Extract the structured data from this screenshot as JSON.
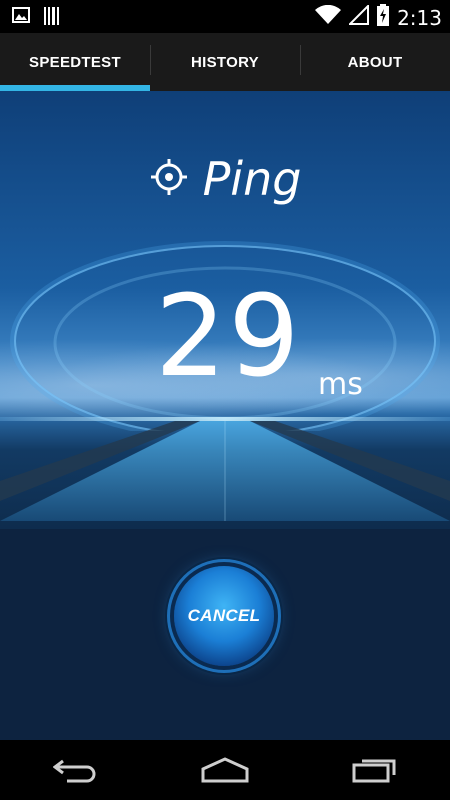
{
  "status_bar": {
    "time": "2:13",
    "icons": [
      "image-icon",
      "barcode-icon",
      "wifi-icon",
      "signal-icon",
      "battery-charging-icon"
    ]
  },
  "tabs": [
    {
      "label": "SPEEDTEST",
      "active": true
    },
    {
      "label": "HISTORY",
      "active": false
    },
    {
      "label": "ABOUT",
      "active": false
    }
  ],
  "test": {
    "title": "Ping",
    "icon": "crosshair-icon",
    "value": "29",
    "unit": "ms"
  },
  "cancel_button": {
    "label": "CANCEL"
  },
  "nav_bar": {
    "icons": [
      "back-icon",
      "home-icon",
      "recents-icon"
    ]
  },
  "colors": {
    "tab_indicator": "#33b5e5",
    "background": "#0d2340"
  }
}
